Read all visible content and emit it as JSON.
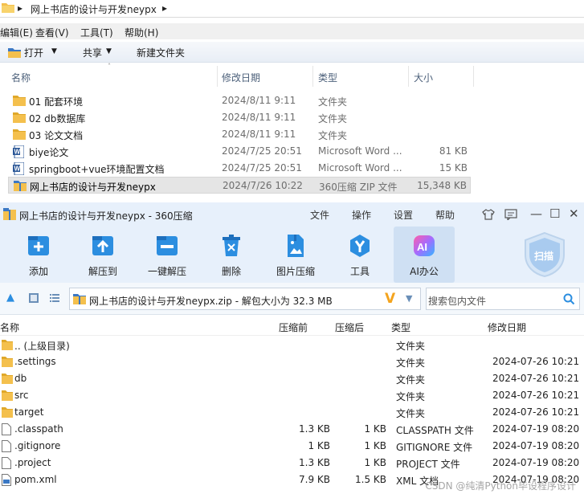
{
  "explorer": {
    "breadcrumb": "网上书店的设计与开发neypx",
    "menu": [
      "编辑(E)",
      "查看(V)",
      "工具(T)",
      "帮助(H)"
    ],
    "toolbar": {
      "open": "打开",
      "share": "共享",
      "new_folder": "新建文件夹"
    },
    "columns": {
      "name": "名称",
      "date": "修改日期",
      "type": "类型",
      "size": "大小"
    },
    "files": [
      {
        "name": "01 配套环境",
        "date": "2024/8/11 9:11",
        "type": "文件夹",
        "size": "",
        "icon": "folder-icon"
      },
      {
        "name": "02 db数据库",
        "date": "2024/8/11 9:11",
        "type": "文件夹",
        "size": "",
        "icon": "folder-icon"
      },
      {
        "name": "03 论文文档",
        "date": "2024/8/11 9:11",
        "type": "文件夹",
        "size": "",
        "icon": "folder-icon"
      },
      {
        "name": "biye论文",
        "date": "2024/7/25 20:51",
        "type": "Microsoft Word ...",
        "size": "81 KB",
        "icon": "word-doc-icon"
      },
      {
        "name": "springboot+vue环境配置文档",
        "date": "2024/7/25 20:51",
        "type": "Microsoft Word ...",
        "size": "15 KB",
        "icon": "word-doc-icon"
      },
      {
        "name": "网上书店的设计与开发neypx",
        "date": "2024/7/26 10:22",
        "type": "360压缩 ZIP 文件",
        "size": "15,348 KB",
        "icon": "zip-archive-icon",
        "selected": true
      }
    ]
  },
  "zip": {
    "title": "网上书店的设计与开发neypx - 360压缩",
    "menu": [
      "文件",
      "操作",
      "设置",
      "帮助"
    ],
    "tools": [
      {
        "label": "添加",
        "icon": "add-icon"
      },
      {
        "label": "解压到",
        "icon": "extract-to-icon"
      },
      {
        "label": "一键解压",
        "icon": "one-click-extract-icon"
      },
      {
        "label": "删除",
        "icon": "delete-icon"
      },
      {
        "label": "图片压缩",
        "icon": "image-compress-icon"
      },
      {
        "label": "工具",
        "icon": "tools-icon"
      },
      {
        "label": "AI办公",
        "icon": "ai-office-icon"
      }
    ],
    "scan_label": "扫描",
    "path": "网上书店的设计与开发neypx.zip - 解包大小为 32.3 MB",
    "search_placeholder": "搜索包内文件",
    "columns": {
      "name": "名称",
      "packed": "压缩前",
      "compressed": "压缩后",
      "type": "类型",
      "modified": "修改日期"
    },
    "rows": [
      {
        "name": ".. (上级目录)",
        "packed": "",
        "compressed": "",
        "type": "文件夹",
        "modified": "",
        "icon": "folder-icon"
      },
      {
        "name": ".settings",
        "packed": "",
        "compressed": "",
        "type": "文件夹",
        "modified": "2024-07-26 10:21",
        "icon": "folder-icon"
      },
      {
        "name": "db",
        "packed": "",
        "compressed": "",
        "type": "文件夹",
        "modified": "2024-07-26 10:21",
        "icon": "folder-icon"
      },
      {
        "name": "src",
        "packed": "",
        "compressed": "",
        "type": "文件夹",
        "modified": "2024-07-26 10:21",
        "icon": "folder-icon"
      },
      {
        "name": "target",
        "packed": "",
        "compressed": "",
        "type": "文件夹",
        "modified": "2024-07-26 10:21",
        "icon": "folder-icon"
      },
      {
        "name": ".classpath",
        "packed": "1.3 KB",
        "compressed": "1 KB",
        "type": "CLASSPATH 文件",
        "modified": "2024-07-19 08:20",
        "icon": "file-icon"
      },
      {
        "name": ".gitignore",
        "packed": "1 KB",
        "compressed": "1 KB",
        "type": "GITIGNORE 文件",
        "modified": "2024-07-19 08:20",
        "icon": "file-icon"
      },
      {
        "name": ".project",
        "packed": "1.3 KB",
        "compressed": "1 KB",
        "type": "PROJECT 文件",
        "modified": "2024-07-19 08:20",
        "icon": "file-icon"
      },
      {
        "name": "pom.xml",
        "packed": "7.9 KB",
        "compressed": "1.5 KB",
        "type": "XML 文档",
        "modified": "2024-07-19 08:20",
        "icon": "xml-file-icon"
      }
    ]
  },
  "watermark": "CSDN @纯清Python毕设程序设计",
  "colors": {
    "accent": "#2c8ee0",
    "folder": "#f4c04d",
    "toolbar_bg": "#e7f0fb"
  }
}
